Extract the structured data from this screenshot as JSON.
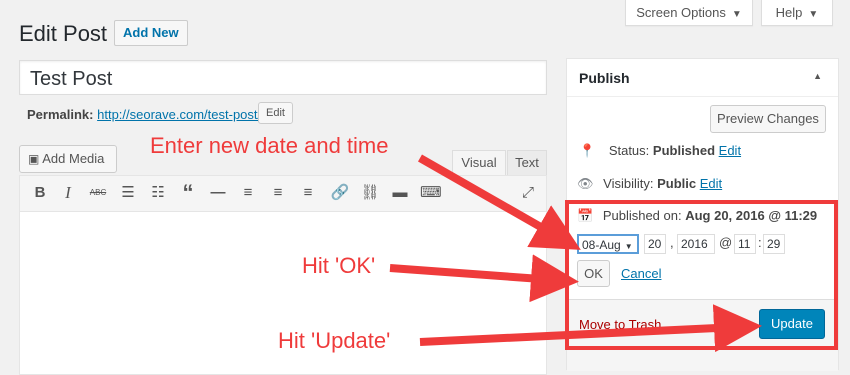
{
  "header": {
    "screen_options": "Screen Options",
    "help": "Help",
    "title": "Edit Post",
    "add_new": "Add New"
  },
  "post": {
    "title_value": "Test Post",
    "permalink_label": "Permalink:",
    "permalink_url": "http://seorave.com/test-post/",
    "edit_label": "Edit"
  },
  "editor": {
    "add_media": "Add Media",
    "tab_visual": "Visual",
    "tab_text": "Text"
  },
  "publish": {
    "heading": "Publish",
    "preview": "Preview Changes",
    "status_label": "Status:",
    "status_value": "Published",
    "status_edit": "Edit",
    "visibility_label": "Visibility:",
    "visibility_value": "Public",
    "visibility_edit": "Edit",
    "published_on_label": "Published on:",
    "published_on_value": "Aug 20, 2016 @ 11:29",
    "month": "08-Aug",
    "day": "20",
    "year": "2016",
    "hour": "11",
    "minute": "29",
    "at": "@",
    "comma": ",",
    "colon": ":",
    "ok": "OK",
    "cancel": "Cancel",
    "trash": "Move to Trash",
    "update": "Update"
  },
  "annotations": {
    "date_time": "Enter new date and time",
    "hit_ok": "Hit 'OK'",
    "hit_update": "Hit 'Update'",
    "color": "#ef3b3b"
  },
  "colors": {
    "link": "#0073aa",
    "primary": "#0085ba",
    "trash": "#a00"
  }
}
